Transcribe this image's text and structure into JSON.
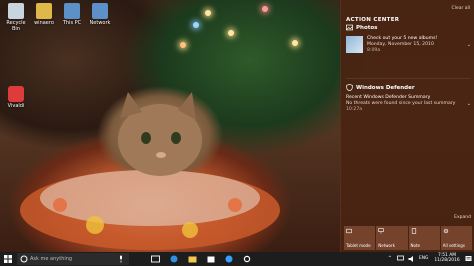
{
  "desktop_icons": [
    {
      "label": "Recycle Bin",
      "color": "#c9d5de"
    },
    {
      "label": "winaero",
      "color": "#e0b84a"
    },
    {
      "label": "This PC",
      "color": "#5d8fc8"
    },
    {
      "label": "Network",
      "color": "#5d8fc8"
    },
    {
      "label": "Vivaldi",
      "color": "#e03b3b"
    }
  ],
  "action_center": {
    "title": "ACTION CENTER",
    "clear_label": "Clear all",
    "groups": [
      {
        "title": "Photos",
        "icon": "photos-icon",
        "notification": {
          "line1": "Check out your 5 new albums!",
          "line2": "Monday, November 15, 2010",
          "time": "8:09a"
        }
      },
      {
        "title": "Windows Defender",
        "icon": "shield-icon",
        "notification": {
          "line1": "Recent Windows Defender Summary",
          "line2": "No threats were found since your last summary",
          "time": "10:27a"
        }
      }
    ],
    "expand_label": "Expand",
    "quick_actions": [
      {
        "label": "Tablet mode",
        "icon": "tablet-icon"
      },
      {
        "label": "Network",
        "icon": "network-icon"
      },
      {
        "label": "Note",
        "icon": "note-icon"
      },
      {
        "label": "All settings",
        "icon": "gear-icon"
      }
    ]
  },
  "taskbar": {
    "search_placeholder": "Ask me anything",
    "time": "7:51 AM",
    "date": "11/28/2016",
    "language": "ENG"
  },
  "colors": {
    "action_center_bg": "#4a2412",
    "tile_bg": "#784629",
    "taskbar_bg": "#1d1d1d"
  }
}
